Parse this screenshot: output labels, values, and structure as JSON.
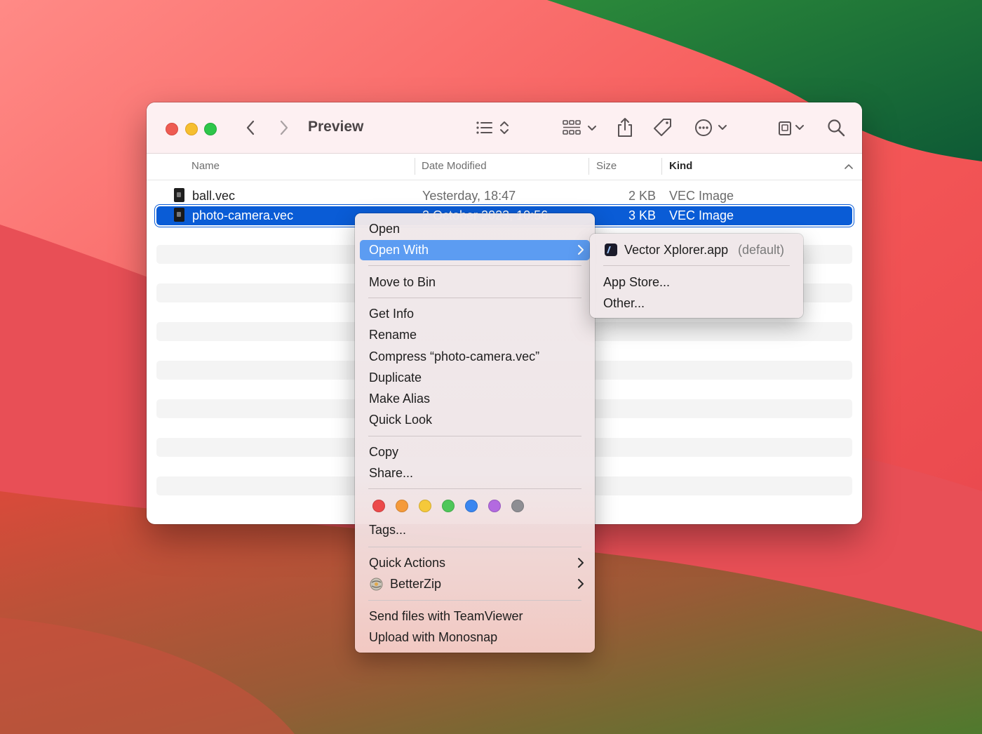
{
  "window": {
    "title": "Preview"
  },
  "columns": {
    "name": "Name",
    "date_modified": "Date Modified",
    "size": "Size",
    "kind": "Kind"
  },
  "files": [
    {
      "name": "ball.vec",
      "date": "Yesterday, 18:47",
      "size": "2 KB",
      "kind": "VEC Image"
    },
    {
      "name": "photo-camera.vec",
      "date": "2 October 2023, 10:56",
      "size": "3 KB",
      "kind": "VEC Image",
      "selected": true
    }
  ],
  "context_menu": {
    "open": "Open",
    "open_with": "Open With",
    "move_to_bin": "Move to Bin",
    "get_info": "Get Info",
    "rename": "Rename",
    "compress": "Compress “photo-camera.vec”",
    "duplicate": "Duplicate",
    "make_alias": "Make Alias",
    "quick_look": "Quick Look",
    "copy": "Copy",
    "share": "Share...",
    "tags": "Tags...",
    "quick_actions": "Quick Actions",
    "betterzip": "BetterZip",
    "send_teamviewer": "Send files with TeamViewer",
    "upload_monosnap": "Upload with Monosnap",
    "tag_colors": [
      "#ec4a4a",
      "#f59a3a",
      "#f5c93a",
      "#4ec759",
      "#3a86f0",
      "#b36ae0",
      "#8e8e93"
    ]
  },
  "submenu": {
    "app_name": "Vector Xplorer.app",
    "app_default": "(default)",
    "app_store": "App Store...",
    "other": "Other..."
  },
  "icons": {
    "back": "chevron-left-icon",
    "forward": "chevron-right-icon",
    "list_view": "list-view-icon",
    "group": "grid-group-icon",
    "share": "share-icon",
    "tag": "tag-icon",
    "action": "ellipsis-circle-icon",
    "drive": "drive-icon",
    "search": "search-icon"
  }
}
